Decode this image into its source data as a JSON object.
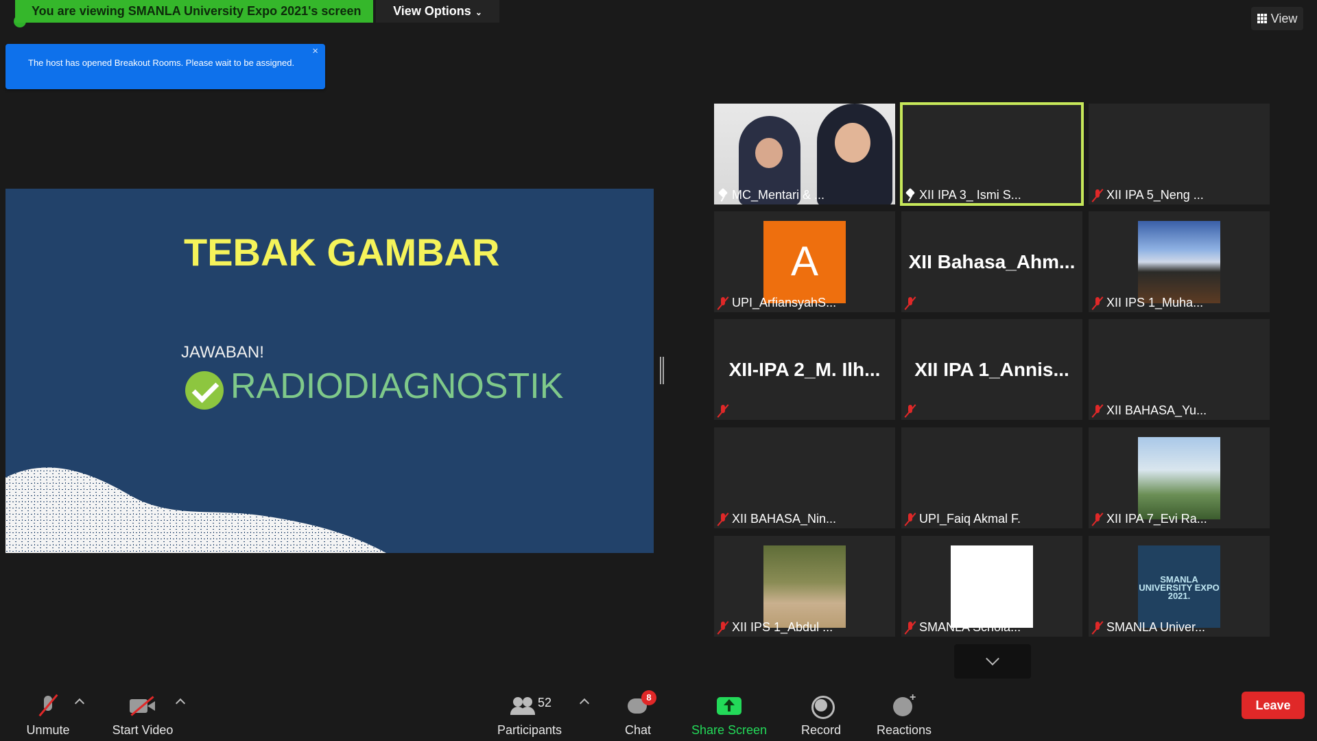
{
  "banner": {
    "text": "You are viewing SMANLA University Expo 2021's screen",
    "view_options": "View Options"
  },
  "view_button": "View",
  "notification": {
    "text": "The host has opened Breakout Rooms. Please wait to be assigned.",
    "close": "×"
  },
  "slide": {
    "title": "TEBAK GAMBAR",
    "label": "JAWABAN!",
    "answer": "RADIODIAGNOSTIK"
  },
  "participants": [
    {
      "name": "MC_Mentari & ...",
      "icon": "pin-icon",
      "video": "photo"
    },
    {
      "name": "XII IPA 3_ Ismi S...",
      "icon": "pin-icon",
      "video": "blank",
      "active": true
    },
    {
      "name": "XII IPA 5_Neng ...",
      "icon": "mic-off-icon",
      "video": "blank"
    },
    {
      "name": "UPI_ArfiansyahS...",
      "icon": "mic-off-icon",
      "video": "avatar",
      "avatar_letter": "A"
    },
    {
      "name": "",
      "icon": "mic-off-icon",
      "video": "name",
      "big_name": "XII  Bahasa_Ahm..."
    },
    {
      "name": "XII IPS 1_Muha...",
      "icon": "mic-off-icon",
      "video": "photo"
    },
    {
      "name": "",
      "icon": "mic-off-icon",
      "video": "name",
      "big_name": "XII-IPA  2_M.  Ilh..."
    },
    {
      "name": "",
      "icon": "mic-off-icon",
      "video": "name",
      "big_name": "XII  IPA  1_Annis..."
    },
    {
      "name": "XII BAHASA_Yu...",
      "icon": "mic-off-icon",
      "video": "blank"
    },
    {
      "name": "XII BAHASA_Nin...",
      "icon": "mic-off-icon",
      "video": "blank"
    },
    {
      "name": "UPI_Faiq Akmal F.",
      "icon": "mic-off-icon",
      "video": "blank"
    },
    {
      "name": "XII IPA 7_Evi Ra...",
      "icon": "mic-off-icon",
      "video": "photo"
    },
    {
      "name": "XII IPS 1_Abdul ...",
      "icon": "mic-off-icon",
      "video": "photo"
    },
    {
      "name": "SMANLA Schola...",
      "icon": "mic-off-icon",
      "video": "photo"
    },
    {
      "name": "SMANLA Univer...",
      "icon": "mic-off-icon",
      "video": "logo",
      "logo_text": "SMANLA UNIVERSITY EXPO 2021."
    }
  ],
  "toolbar": {
    "unmute": "Unmute",
    "start_video": "Start Video",
    "participants": "Participants",
    "participants_count": "52",
    "chat": "Chat",
    "chat_badge": "8",
    "share_screen": "Share Screen",
    "record": "Record",
    "reactions": "Reactions",
    "leave": "Leave"
  },
  "colors": {
    "accent_green": "#35b72b",
    "share_green": "#23d959",
    "leave_red": "#e02828",
    "slide_bg": "#22426a",
    "title_yellow": "#f5f35a",
    "notice_blue": "#0e71eb"
  }
}
